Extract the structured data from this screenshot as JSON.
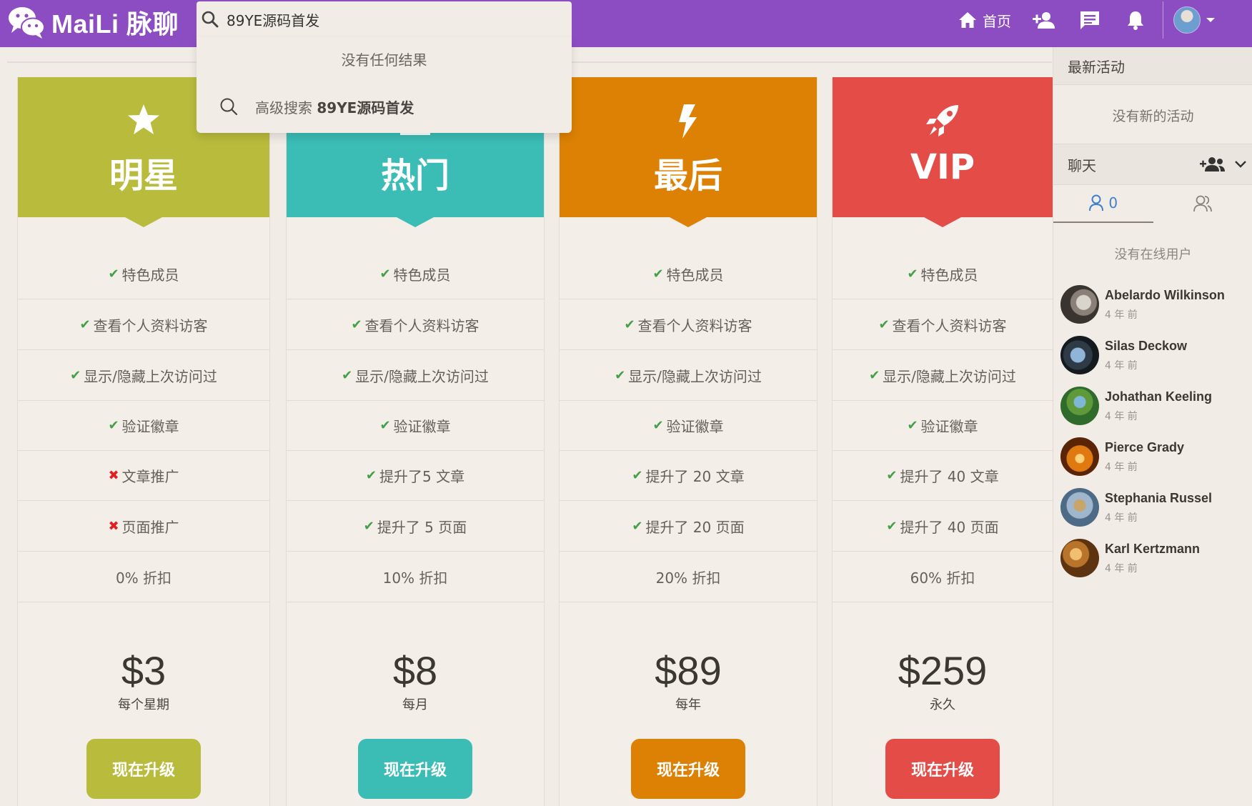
{
  "brand": {
    "name": "MaiLi 脉聊"
  },
  "search": {
    "query": "89YE源码首发",
    "no_results": "没有任何结果",
    "advanced_prefix": "高级搜索",
    "advanced_term": "89YE源码首发"
  },
  "nav": {
    "home_label": "首页"
  },
  "plans": [
    {
      "title": "明星",
      "color": "#b9bb3c",
      "icon": "star-icon",
      "features": [
        {
          "ok": true,
          "text": "特色成员"
        },
        {
          "ok": true,
          "text": "查看个人资料访客"
        },
        {
          "ok": true,
          "text": "显示/隐藏上次访问过"
        },
        {
          "ok": true,
          "text": "验证徽章"
        },
        {
          "ok": false,
          "text": "文章推广"
        },
        {
          "ok": false,
          "text": "页面推广"
        },
        {
          "ok": null,
          "text": "0% 折扣"
        }
      ],
      "price": "$3",
      "period": "每个星期",
      "button": "现在升级"
    },
    {
      "title": "热门",
      "color": "#3bbdb5",
      "icon": "trending-icon",
      "features": [
        {
          "ok": true,
          "text": "特色成员"
        },
        {
          "ok": true,
          "text": "查看个人资料访客"
        },
        {
          "ok": true,
          "text": "显示/隐藏上次访问过"
        },
        {
          "ok": true,
          "text": "验证徽章"
        },
        {
          "ok": true,
          "text": "提升了5 文章"
        },
        {
          "ok": true,
          "text": "提升了 5 页面"
        },
        {
          "ok": null,
          "text": "10% 折扣"
        }
      ],
      "price": "$8",
      "period": "每月",
      "button": "现在升级"
    },
    {
      "title": "最后",
      "color": "#dd8104",
      "icon": "lightning-icon",
      "features": [
        {
          "ok": true,
          "text": "特色成员"
        },
        {
          "ok": true,
          "text": "查看个人资料访客"
        },
        {
          "ok": true,
          "text": "显示/隐藏上次访问过"
        },
        {
          "ok": true,
          "text": "验证徽章"
        },
        {
          "ok": true,
          "text": "提升了 20 文章"
        },
        {
          "ok": true,
          "text": "提升了 20 页面"
        },
        {
          "ok": null,
          "text": "20% 折扣"
        }
      ],
      "price": "$89",
      "period": "每年",
      "button": "现在升级"
    },
    {
      "title": "VIP",
      "color": "#e44c47",
      "icon": "rocket-icon",
      "features": [
        {
          "ok": true,
          "text": "特色成员"
        },
        {
          "ok": true,
          "text": "查看个人资料访客"
        },
        {
          "ok": true,
          "text": "显示/隐藏上次访问过"
        },
        {
          "ok": true,
          "text": "验证徽章"
        },
        {
          "ok": true,
          "text": "提升了 40 文章"
        },
        {
          "ok": true,
          "text": "提升了 40 页面"
        },
        {
          "ok": null,
          "text": "60% 折扣"
        }
      ],
      "price": "$259",
      "period": "永久",
      "button": "现在升级"
    }
  ],
  "sidebar": {
    "activity_title": "最新活动",
    "activity_empty": "没有新的活动",
    "chat_title": "聊天",
    "online_count": "0",
    "no_online": "没有在线用户",
    "users": [
      {
        "name": "Abelardo Wilkinson",
        "time": "4 年 前"
      },
      {
        "name": "Silas Deckow",
        "time": "4 年 前"
      },
      {
        "name": "Johathan Keeling",
        "time": "4 年 前"
      },
      {
        "name": "Pierce Grady",
        "time": "4 年 前"
      },
      {
        "name": "Stephania Russel",
        "time": "4 年 前"
      },
      {
        "name": "Karl Kertzmann",
        "time": "4 年 前"
      }
    ]
  }
}
